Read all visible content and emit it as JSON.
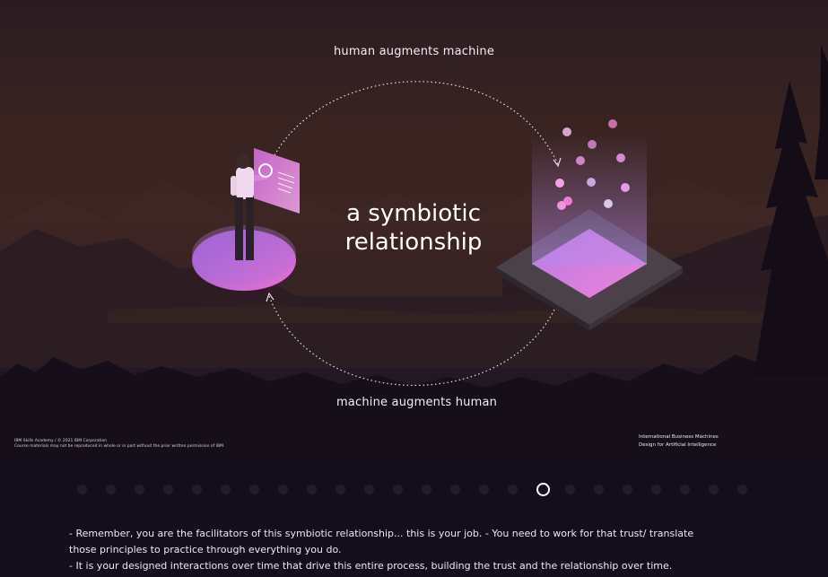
{
  "slide": {
    "top_label": "human augments machine",
    "bottom_label": "machine augments human",
    "headline_line1": "a symbiotic",
    "headline_line2": "relationship",
    "copyright_line1": "IBM Skills Academy / © 2021 IBM Corporation",
    "copyright_line2": "Course materials may not be reproduced in whole or in part without the prior written permission of IBM.",
    "org_line1": "International Business Machines",
    "org_line2": "Design for Artificial Intelligence"
  },
  "pager": {
    "count": 24,
    "active_index": 16
  },
  "notes": [
    "- Remember, you are the facilitators of this symbiotic relationship... this is your job. - You need to work for that trust/ translate those principles to practice through everything you do.",
    "- It is your designed interactions over time that drive this entire process, building the trust and the relationship over time."
  ],
  "colors": {
    "accent_pink": "#e07ad8",
    "accent_purple": "#9b6ad6",
    "background": "#140e1c"
  }
}
